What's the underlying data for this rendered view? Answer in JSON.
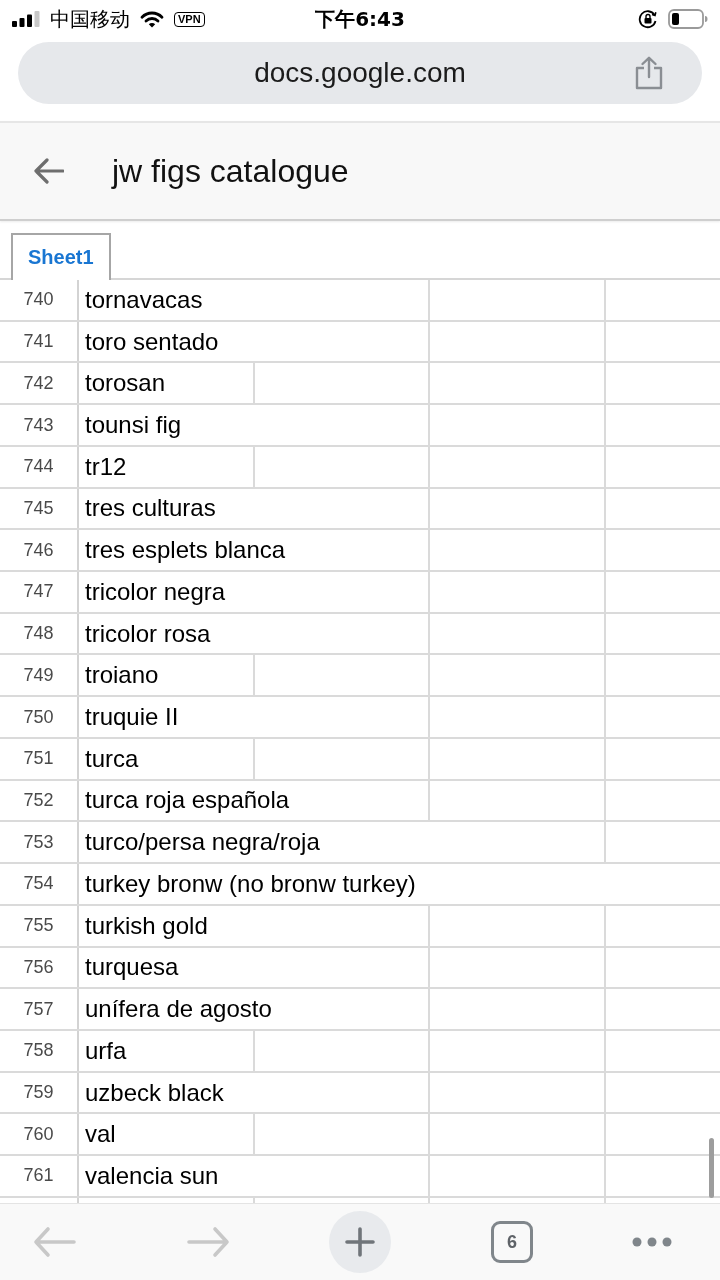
{
  "status_bar": {
    "carrier": "中国移动",
    "vpn": "VPN",
    "time": "下午6:43"
  },
  "address_bar": {
    "url": "docs.google.com"
  },
  "header": {
    "title": "jw figs catalogue"
  },
  "sheet_tabs": [
    {
      "label": "Sheet1",
      "selected": true
    }
  ],
  "rows": [
    {
      "number": "740",
      "text": "tornavacas",
      "kind": "span2"
    },
    {
      "number": "741",
      "text": "toro sentado",
      "kind": "span2"
    },
    {
      "number": "742",
      "text": "torosan",
      "kind": "span1"
    },
    {
      "number": "743",
      "text": "tounsi fig",
      "kind": "span2"
    },
    {
      "number": "744",
      "text": "tr12",
      "kind": "span1"
    },
    {
      "number": "745",
      "text": "tres culturas",
      "kind": "span2"
    },
    {
      "number": "746",
      "text": "tres esplets blanca",
      "kind": "span2"
    },
    {
      "number": "747",
      "text": "tricolor negra",
      "kind": "span2"
    },
    {
      "number": "748",
      "text": "tricolor rosa",
      "kind": "span2"
    },
    {
      "number": "749",
      "text": "troiano",
      "kind": "span1"
    },
    {
      "number": "750",
      "text": "truquie II",
      "kind": "span2"
    },
    {
      "number": "751",
      "text": "turca",
      "kind": "span1"
    },
    {
      "number": "752",
      "text": "turca roja española",
      "kind": "span2"
    },
    {
      "number": "753",
      "text": "turco/persa negra/roja",
      "kind": "span3"
    },
    {
      "number": "754",
      "text": "turkey bronw (no bronw turkey)",
      "kind": "span4"
    },
    {
      "number": "755",
      "text": "turkish gold",
      "kind": "span2"
    },
    {
      "number": "756",
      "text": "turquesa",
      "kind": "span2"
    },
    {
      "number": "757",
      "text": "unífera de agosto",
      "kind": "span2"
    },
    {
      "number": "758",
      "text": "urfa",
      "kind": "span1"
    },
    {
      "number": "759",
      "text": "uzbeck black",
      "kind": "span2"
    },
    {
      "number": "760",
      "text": "val",
      "kind": "span1"
    },
    {
      "number": "761",
      "text": "valencia sun",
      "kind": "span2"
    }
  ],
  "toolbar": {
    "back": {
      "disabled": true
    },
    "forward": {
      "disabled": true
    },
    "tab_count": "6"
  }
}
